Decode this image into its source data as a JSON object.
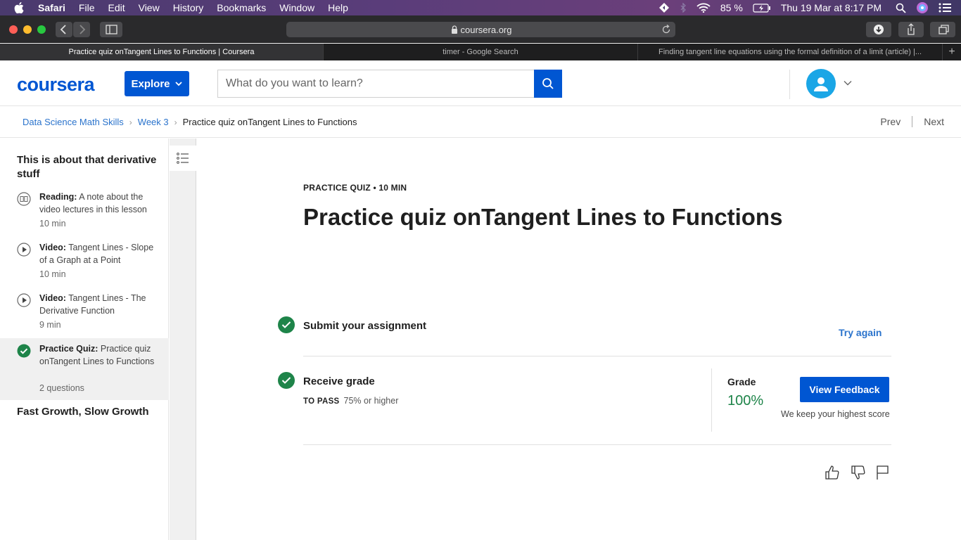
{
  "menubar": {
    "app": "Safari",
    "items": [
      "File",
      "Edit",
      "View",
      "History",
      "Bookmarks",
      "Window",
      "Help"
    ],
    "battery": "85 %",
    "datetime": "Thu 19 Mar at  8:17 PM"
  },
  "browser": {
    "url": "coursera.org",
    "tabs": [
      {
        "label": "Practice quiz onTangent Lines to Functions | Coursera",
        "active": true
      },
      {
        "label": "timer - Google Search",
        "active": false
      },
      {
        "label": "Finding tangent line equations using the formal definition of a limit (article) |...",
        "active": false
      }
    ],
    "new_tab": "+"
  },
  "header": {
    "logo": "coursera",
    "explore_label": "Explore",
    "search_placeholder": "What do you want to learn?"
  },
  "breadcrumb": {
    "course": "Data Science Math Skills",
    "week": "Week 3",
    "current": "Practice quiz onTangent Lines to Functions",
    "prev": "Prev",
    "next": "Next"
  },
  "sidebar": {
    "section_title": "This is about that derivative stuff",
    "items": [
      {
        "kind": "Reading:",
        "title": "A note about the video lectures in this lesson",
        "duration": "10 min"
      },
      {
        "kind": "Video:",
        "title": "Tangent Lines - Slope of a Graph at a Point",
        "duration": "10 min"
      },
      {
        "kind": "Video:",
        "title": "Tangent Lines - The Derivative Function",
        "duration": "9 min"
      },
      {
        "kind": "Practice Quiz:",
        "title": "Practice quiz onTangent Lines to Functions",
        "duration": "2 questions"
      }
    ],
    "next_section": "Fast Growth, Slow Growth"
  },
  "main": {
    "kicker": "PRACTICE QUIZ • 10 MIN",
    "title": "Practice quiz onTangent Lines to Functions",
    "submit_label": "Submit your assignment",
    "try_again": "Try again",
    "receive_label": "Receive grade",
    "to_pass_label": "TO PASS",
    "to_pass_value": "75% or higher",
    "grade_label": "Grade",
    "grade_value": "100%",
    "view_feedback": "View Feedback",
    "keep_highest": "We keep your highest score"
  },
  "colors": {
    "brand_blue": "#0056d2",
    "link_blue": "#2a73cc",
    "success_green": "#1e8449"
  }
}
